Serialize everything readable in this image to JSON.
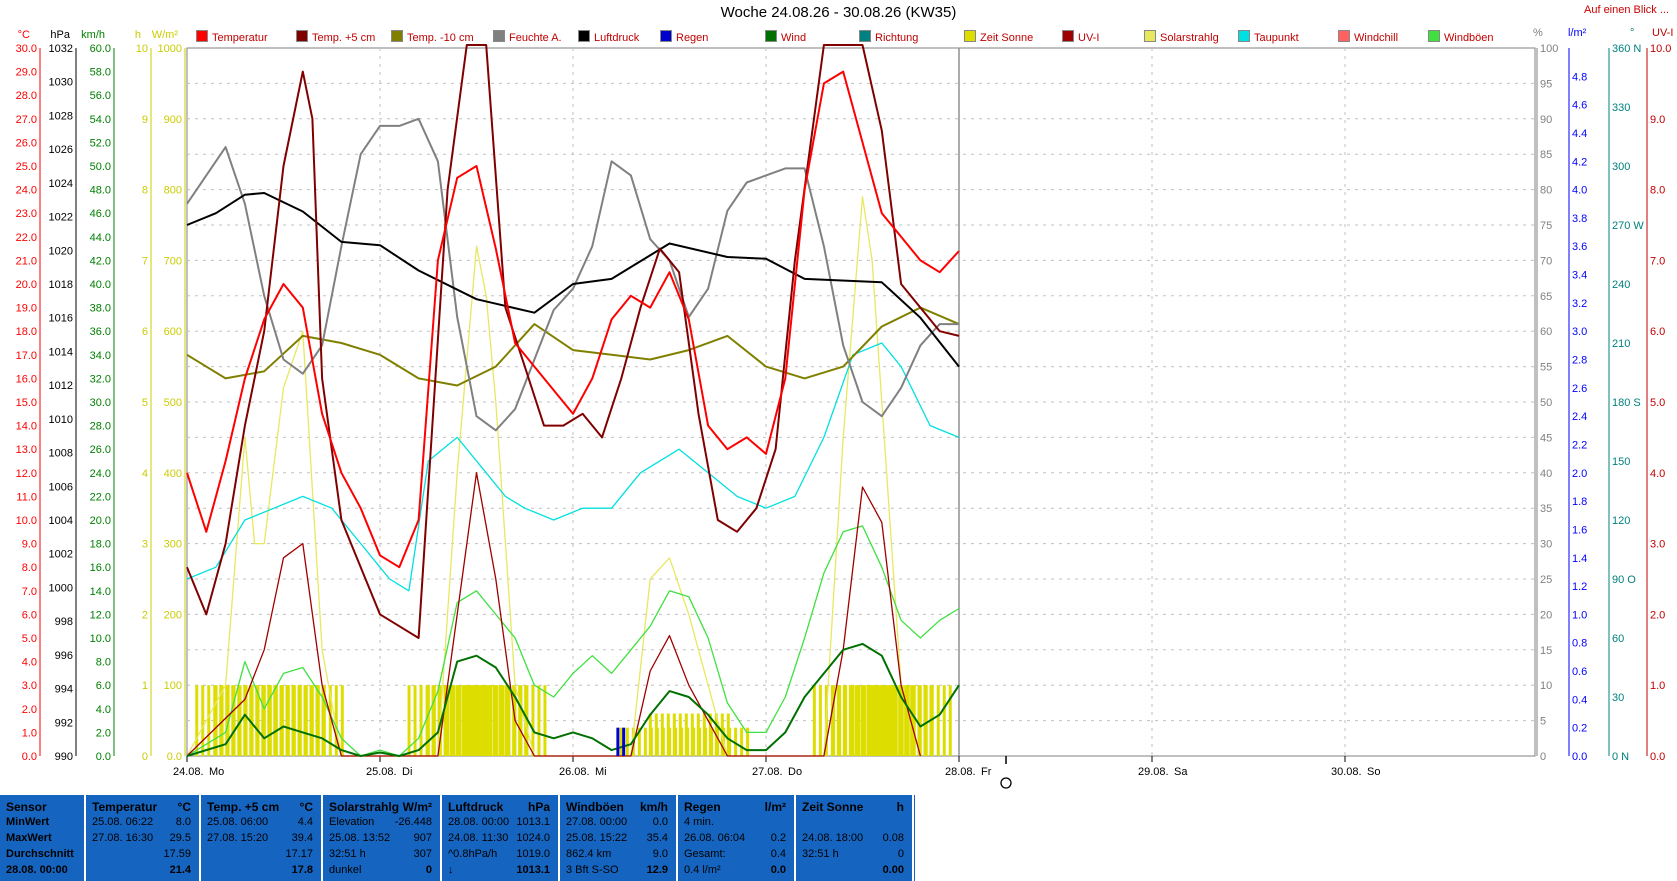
{
  "title": "Woche 24.08.26 - 30.08.26 (KW35)",
  "top_link": "Auf einen Blick ...",
  "colors": {
    "temperatur": "#ff0000",
    "temp5": "#800000",
    "temp10": "#808000",
    "feuchte": "#808080",
    "luftdruck": "#000000",
    "regen": "#0000cc",
    "wind": "#007000",
    "richtung": "#008080",
    "zeit_sonne": "#dddd00",
    "uvi": "#a00000",
    "solar": "#e8e860",
    "taupunkt": "#00e0e0",
    "windchill": "#ff6060",
    "windboeen": "#40e040",
    "footer_bg": "#1565c0"
  },
  "legend": [
    {
      "label": "Temperatur",
      "key": "temperatur"
    },
    {
      "label": "Temp. +5 cm",
      "key": "temp5"
    },
    {
      "label": "Temp. -10 cm",
      "key": "temp10"
    },
    {
      "label": "Feuchte A.",
      "key": "feuchte"
    },
    {
      "label": "Luftdruck",
      "key": "luftdruck"
    },
    {
      "label": "Regen",
      "key": "regen"
    },
    {
      "label": "Wind",
      "key": "wind"
    },
    {
      "label": "Richtung",
      "key": "richtung"
    },
    {
      "label": "Zeit Sonne",
      "key": "zeit_sonne"
    },
    {
      "label": "UV-I",
      "key": "uvi"
    },
    {
      "label": "Solarstrahlg",
      "key": "solar"
    },
    {
      "label": "Taupunkt",
      "key": "taupunkt"
    },
    {
      "label": "Windchill",
      "key": "windchill"
    },
    {
      "label": "Windböen",
      "key": "windboeen"
    }
  ],
  "axis_units": {
    "temp": "°C",
    "hpa": "hPa",
    "kmh": "km/h",
    "h": "h",
    "wm2": "W/m²",
    "pct": "%",
    "lm2": "l/m²",
    "deg": "°",
    "uvi": "UV-I"
  },
  "axes": {
    "temp": [
      "0.0",
      "1.0",
      "2.0",
      "3.0",
      "4.0",
      "5.0",
      "6.0",
      "7.0",
      "8.0",
      "9.0",
      "10.0",
      "11.0",
      "12.0",
      "13.0",
      "14.0",
      "15.0",
      "16.0",
      "17.0",
      "18.0",
      "19.0",
      "20.0",
      "21.0",
      "22.0",
      "23.0",
      "24.0",
      "25.0",
      "26.0",
      "27.0",
      "28.0",
      "29.0",
      "30.0"
    ],
    "hpa": [
      "990",
      "992",
      "994",
      "996",
      "998",
      "1000",
      "1002",
      "1004",
      "1006",
      "1008",
      "1010",
      "1012",
      "1014",
      "1016",
      "1018",
      "1020",
      "1022",
      "1024",
      "1026",
      "1028",
      "1030",
      "1032"
    ],
    "kmh": [
      "0.0",
      "2.0",
      "4.0",
      "6.0",
      "8.0",
      "10.0",
      "12.0",
      "14.0",
      "16.0",
      "18.0",
      "20.0",
      "22.0",
      "24.0",
      "26.0",
      "28.0",
      "30.0",
      "32.0",
      "34.0",
      "36.0",
      "38.0",
      "40.0",
      "42.0",
      "44.0",
      "46.0",
      "48.0",
      "50.0",
      "52.0",
      "54.0",
      "56.0",
      "58.0",
      "60.0"
    ],
    "h": [
      "0",
      "1",
      "2",
      "3",
      "4",
      "5",
      "6",
      "7",
      "8",
      "9",
      "10"
    ],
    "wm2": [
      "0.0",
      "100",
      "200",
      "300",
      "400",
      "500",
      "600",
      "700",
      "800",
      "900",
      "1000"
    ],
    "pct": [
      "0",
      "5",
      "10",
      "15",
      "20",
      "25",
      "30",
      "35",
      "40",
      "45",
      "50",
      "55",
      "60",
      "65",
      "70",
      "75",
      "80",
      "85",
      "90",
      "95",
      "100"
    ],
    "lm2": [
      "0.0",
      "0.2",
      "0.4",
      "0.6",
      "0.8",
      "1.0",
      "1.2",
      "1.4",
      "1.6",
      "1.8",
      "2.0",
      "2.2",
      "2.4",
      "2.6",
      "2.8",
      "3.0",
      "3.2",
      "3.4",
      "3.6",
      "3.8",
      "4.0",
      "4.2",
      "4.4",
      "4.6",
      "4.8"
    ],
    "deg": [
      "0 N",
      "30",
      "60",
      "90 O",
      "120",
      "150",
      "180 S",
      "210",
      "240",
      "270 W",
      "300",
      "330",
      "360 N"
    ],
    "uvi": [
      "0.0",
      "1.0",
      "2.0",
      "3.0",
      "4.0",
      "5.0",
      "6.0",
      "7.0",
      "8.0",
      "9.0",
      "10.0"
    ]
  },
  "days": [
    {
      "date": "24.08.",
      "name": "Mo"
    },
    {
      "date": "25.08.",
      "name": "Di"
    },
    {
      "date": "26.08.",
      "name": "Mi"
    },
    {
      "date": "27.08.",
      "name": "Do"
    },
    {
      "date": "28.08.",
      "name": "Fr"
    },
    {
      "date": "29.08.",
      "name": "Sa"
    },
    {
      "date": "30.08.",
      "name": "So"
    }
  ],
  "chart_data": {
    "type": "line",
    "title": "Woche 24.08.26 - 30.08.26 (KW35)",
    "x_unit": "days from 24.08. 00:00",
    "xlim": [
      0,
      7
    ],
    "series": [
      {
        "name": "Luftdruck",
        "key": "luftdruck",
        "axis": "hpa",
        "ylim": [
          990,
          1032
        ],
        "x": [
          0,
          0.15,
          0.3,
          0.4,
          0.6,
          0.8,
          1.0,
          1.2,
          1.5,
          1.8,
          2.0,
          2.2,
          2.5,
          2.8,
          3.0,
          3.2,
          3.6,
          3.8,
          4.0
        ],
        "y": [
          1021.5,
          1022.2,
          1023.3,
          1023.4,
          1022.3,
          1020.5,
          1020.3,
          1018.8,
          1017.1,
          1016.3,
          1018.0,
          1018.3,
          1020.4,
          1019.6,
          1019.5,
          1018.3,
          1018.1,
          1016.0,
          1013.1
        ]
      },
      {
        "name": "Temperatur",
        "key": "temperatur",
        "axis": "temp",
        "ylim": [
          0,
          30
        ],
        "x": [
          0,
          0.1,
          0.2,
          0.3,
          0.4,
          0.5,
          0.6,
          0.7,
          0.8,
          0.9,
          1.0,
          1.1,
          1.2,
          1.3,
          1.4,
          1.5,
          1.6,
          1.7,
          1.8,
          1.9,
          2.0,
          2.1,
          2.2,
          2.3,
          2.4,
          2.5,
          2.6,
          2.7,
          2.8,
          2.9,
          3.0,
          3.1,
          3.2,
          3.3,
          3.4,
          3.5,
          3.6,
          3.7,
          3.8,
          3.9,
          4.0
        ],
        "y": [
          12.0,
          9.5,
          12.5,
          16.0,
          18.5,
          20.0,
          19.0,
          14.5,
          12.0,
          10.5,
          8.5,
          8.0,
          10.0,
          21.0,
          24.5,
          25.0,
          21.5,
          17.5,
          16.5,
          15.5,
          14.5,
          16.0,
          18.5,
          19.5,
          19.0,
          20.5,
          18.5,
          14.0,
          13.0,
          13.5,
          12.8,
          16.0,
          24.0,
          28.5,
          29.0,
          26.0,
          23.0,
          22.0,
          21.0,
          20.5,
          21.4
        ]
      },
      {
        "name": "Temp. +5 cm",
        "key": "temp5",
        "axis": "temp",
        "ylim": [
          0,
          30
        ],
        "x": [
          0,
          0.1,
          0.2,
          0.3,
          0.4,
          0.5,
          0.6,
          0.65,
          0.7,
          0.8,
          0.9,
          1.0,
          1.1,
          1.2,
          1.35,
          1.45,
          1.55,
          1.65,
          1.75,
          1.85,
          1.95,
          2.05,
          2.15,
          2.25,
          2.35,
          2.45,
          2.55,
          2.65,
          2.75,
          2.85,
          2.95,
          3.05,
          3.15,
          3.3,
          3.4,
          3.5,
          3.6,
          3.7,
          3.8,
          3.9,
          4.0
        ],
        "y": [
          8.0,
          6.0,
          9.0,
          14.0,
          18.0,
          25.0,
          29.0,
          27.0,
          16.0,
          10.0,
          8.0,
          6.0,
          5.5,
          5.0,
          24.0,
          32.0,
          32.0,
          19.0,
          16.5,
          14.0,
          14.0,
          14.5,
          13.5,
          16.0,
          19.0,
          21.5,
          20.5,
          14.5,
          10.0,
          9.5,
          10.5,
          13.0,
          21.0,
          35.0,
          39.4,
          33.0,
          26.5,
          20.0,
          19.0,
          18.0,
          17.8
        ]
      },
      {
        "name": "Temp. -10 cm",
        "key": "temp10",
        "axis": "temp",
        "ylim": [
          0,
          30
        ],
        "x": [
          0,
          0.2,
          0.4,
          0.6,
          0.8,
          1.0,
          1.2,
          1.4,
          1.6,
          1.8,
          2.0,
          2.2,
          2.4,
          2.6,
          2.8,
          3.0,
          3.2,
          3.4,
          3.6,
          3.8,
          4.0
        ],
        "y": [
          17.0,
          16.0,
          16.3,
          17.8,
          17.5,
          17.0,
          16.0,
          15.7,
          16.5,
          18.3,
          17.2,
          17.0,
          16.8,
          17.2,
          17.8,
          16.5,
          16.0,
          16.5,
          18.2,
          19.0,
          18.3
        ]
      },
      {
        "name": "Feuchte A.",
        "key": "feuchte",
        "axis": "pct",
        "ylim": [
          0,
          100
        ],
        "x": [
          0,
          0.1,
          0.2,
          0.3,
          0.4,
          0.5,
          0.6,
          0.7,
          0.8,
          0.9,
          1.0,
          1.1,
          1.2,
          1.3,
          1.4,
          1.5,
          1.6,
          1.7,
          1.8,
          1.9,
          2.0,
          2.1,
          2.2,
          2.3,
          2.4,
          2.5,
          2.6,
          2.7,
          2.8,
          2.9,
          3.0,
          3.1,
          3.2,
          3.3,
          3.4,
          3.5,
          3.6,
          3.7,
          3.8,
          3.9,
          4.0
        ],
        "y": [
          78,
          82,
          86,
          78,
          65,
          56,
          54,
          58,
          72,
          85,
          89,
          89,
          90,
          84,
          62,
          48,
          46,
          49,
          56,
          63,
          66,
          72,
          84,
          82,
          73,
          70,
          62,
          66,
          77,
          81,
          82,
          83,
          83,
          72,
          58,
          50,
          48,
          52,
          58,
          61,
          61
        ]
      },
      {
        "name": "Taupunkt",
        "key": "taupunkt",
        "axis": "temp",
        "ylim": [
          0,
          30
        ],
        "x": [
          0,
          0.15,
          0.3,
          0.45,
          0.6,
          0.75,
          0.9,
          1.05,
          1.15,
          1.25,
          1.4,
          1.55,
          1.65,
          1.75,
          1.9,
          2.05,
          2.2,
          2.35,
          2.55,
          2.7,
          2.85,
          3.0,
          3.15,
          3.3,
          3.45,
          3.6,
          3.7,
          3.85,
          4.0
        ],
        "y": [
          7.5,
          8.0,
          10.0,
          10.5,
          11.0,
          10.5,
          9.0,
          7.5,
          7.0,
          12.5,
          13.5,
          12.0,
          11.0,
          10.5,
          10.0,
          10.5,
          10.5,
          12.0,
          13.0,
          12.0,
          11.0,
          10.5,
          11.0,
          13.5,
          17.0,
          17.5,
          16.5,
          14.0,
          13.5
        ]
      },
      {
        "name": "Wind",
        "key": "wind",
        "axis": "kmh",
        "ylim": [
          0,
          60
        ],
        "x": [
          0,
          0.2,
          0.3,
          0.4,
          0.5,
          0.6,
          0.7,
          0.8,
          0.9,
          1.0,
          1.1,
          1.2,
          1.3,
          1.4,
          1.5,
          1.6,
          1.7,
          1.8,
          1.9,
          2.0,
          2.1,
          2.2,
          2.3,
          2.4,
          2.5,
          2.6,
          2.7,
          2.8,
          2.9,
          3.0,
          3.1,
          3.2,
          3.3,
          3.4,
          3.5,
          3.6,
          3.7,
          3.8,
          3.9,
          4.0
        ],
        "y": [
          0,
          1.0,
          3.5,
          1.5,
          2.5,
          2.0,
          1.5,
          0.5,
          0,
          0.3,
          0,
          0.5,
          2.0,
          8.0,
          8.5,
          7.5,
          5.0,
          2.0,
          1.5,
          2.0,
          1.5,
          0.5,
          1.0,
          3.5,
          5.5,
          5.0,
          3.5,
          1.5,
          0.5,
          0.5,
          2.0,
          5.0,
          7.0,
          9.0,
          9.5,
          8.5,
          5.0,
          2.5,
          3.5,
          6.0
        ]
      },
      {
        "name": "Windböen",
        "key": "windboeen",
        "axis": "kmh",
        "ylim": [
          0,
          60
        ],
        "x": [
          0,
          0.2,
          0.3,
          0.4,
          0.5,
          0.6,
          0.7,
          0.8,
          0.9,
          1.0,
          1.1,
          1.2,
          1.3,
          1.4,
          1.5,
          1.6,
          1.7,
          1.8,
          1.9,
          2.0,
          2.1,
          2.2,
          2.3,
          2.4,
          2.5,
          2.6,
          2.7,
          2.8,
          2.9,
          3.0,
          3.1,
          3.2,
          3.3,
          3.4,
          3.5,
          3.6,
          3.7,
          3.8,
          3.9,
          4.0
        ],
        "y": [
          0,
          2.0,
          8.0,
          4.0,
          7.0,
          7.5,
          5.0,
          1.5,
          0,
          0.5,
          0,
          1.5,
          5.5,
          13.0,
          14.0,
          12.0,
          10.0,
          6.0,
          5.0,
          7.0,
          8.5,
          7.0,
          9.0,
          11.0,
          14.0,
          13.5,
          10.0,
          4.5,
          2.0,
          2.0,
          5.0,
          10.0,
          15.5,
          19.0,
          19.5,
          16.0,
          11.5,
          10.0,
          11.5,
          12.5
        ]
      },
      {
        "name": "UV-I",
        "key": "uvi",
        "axis": "uvi",
        "ylim": [
          0,
          10
        ],
        "x": [
          0,
          0.3,
          0.4,
          0.5,
          0.6,
          0.7,
          0.8,
          1.3,
          1.4,
          1.5,
          1.6,
          1.7,
          1.8,
          2.3,
          2.4,
          2.5,
          2.6,
          2.7,
          2.8,
          3.3,
          3.4,
          3.5,
          3.6,
          3.7,
          3.8
        ],
        "y": [
          0,
          0.8,
          1.5,
          2.8,
          3.0,
          1.0,
          0,
          0,
          2.0,
          4.0,
          2.5,
          0.5,
          0,
          0,
          1.2,
          1.7,
          1.0,
          0.5,
          0,
          0,
          1.5,
          3.8,
          3.3,
          1.0,
          0
        ]
      },
      {
        "name": "Solarstrahlg",
        "key": "solar",
        "axis": "wm2",
        "ylim": [
          0,
          1000
        ],
        "x": [
          0,
          0.2,
          0.3,
          0.35,
          0.4,
          0.5,
          0.6,
          0.7,
          0.8,
          1.3,
          1.4,
          1.5,
          1.55,
          1.6,
          1.7,
          1.8,
          2.3,
          2.4,
          2.5,
          2.6,
          2.7,
          2.8,
          3.3,
          3.4,
          3.5,
          3.55,
          3.6,
          3.7,
          3.8
        ],
        "y": [
          0,
          100,
          450,
          300,
          300,
          520,
          600,
          150,
          0,
          0,
          400,
          720,
          650,
          500,
          100,
          0,
          0,
          250,
          280,
          200,
          100,
          0,
          0,
          450,
          790,
          700,
          500,
          100,
          0
        ]
      },
      {
        "name": "Zeit Sonne",
        "key": "zeit_sonne",
        "axis": "h",
        "ylim": [
          0,
          10
        ],
        "x": [
          0.25,
          0.35,
          0.5,
          0.6,
          1.35,
          1.45,
          1.55,
          1.65,
          2.45,
          2.6,
          2.7,
          3.45,
          3.55,
          3.65,
          3.75
        ],
        "y": [
          1,
          1,
          1,
          1,
          1,
          1,
          1,
          1,
          0.4,
          0.6,
          0.4,
          1,
          1,
          1,
          1
        ]
      },
      {
        "name": "Regen",
        "key": "regen",
        "axis": "lm2",
        "ylim": [
          0,
          5
        ],
        "x": [
          2.23,
          2.26
        ],
        "y": [
          0.2,
          0.2
        ]
      }
    ]
  },
  "footer": {
    "sensor": {
      "head": "Sensor",
      "rows": [
        "MinWert",
        "MaxWert",
        "Durchschnitt",
        "28.08. 00:00"
      ]
    },
    "temperatur": {
      "head": "Temperatur",
      "unit": "°C",
      "rows": [
        [
          "25.08.  06:22",
          "8.0"
        ],
        [
          "27.08.  16:30",
          "29.5"
        ],
        [
          "",
          "17.59"
        ],
        [
          "",
          "21.4"
        ]
      ]
    },
    "temp5": {
      "head": "Temp. +5 cm",
      "unit": "°C",
      "rows": [
        [
          "25.08.  06:00",
          "4.4"
        ],
        [
          "27.08.  15:20",
          "39.4"
        ],
        [
          "",
          "17.17"
        ],
        [
          "",
          "17.8"
        ]
      ]
    },
    "solar": {
      "head": "Solarstrahlg",
      "unit": "W/m²",
      "rows": [
        [
          "Elevation",
          "-26.448"
        ],
        [
          "25.08.  13:52",
          "907"
        ],
        [
          "32:51 h",
          "307"
        ],
        [
          "dunkel",
          "0"
        ]
      ]
    },
    "luftdruck": {
      "head": "Luftdruck",
      "unit": "hPa",
      "rows": [
        [
          "28.08.  00:00",
          "1013.1"
        ],
        [
          "24.08.  11:30",
          "1024.0"
        ],
        [
          "^0.8hPa/h",
          "1019.0"
        ],
        [
          "↓",
          "1013.1"
        ]
      ]
    },
    "windboeen": {
      "head": "Windböen",
      "unit": "km/h",
      "rows": [
        [
          "27.08.  00:00",
          "0.0"
        ],
        [
          "25.08.  15:22",
          "35.4"
        ],
        [
          "862.4 km",
          "9.0"
        ],
        [
          "3 Bft S-SO",
          "12.9"
        ]
      ]
    },
    "regen": {
      "head": "Regen",
      "unit": "l/m²",
      "rows": [
        [
          "4 min.",
          ""
        ],
        [
          "26.08.  06:04",
          "0.2"
        ],
        [
          "Gesamt:",
          "0.4"
        ],
        [
          "0.4 l/m²",
          "0.0"
        ]
      ]
    },
    "sonne": {
      "head": "Zeit Sonne",
      "unit": "h",
      "rows": [
        [
          "",
          ""
        ],
        [
          "24.08.  18:00",
          "0.08"
        ],
        [
          "32:51 h",
          "0"
        ],
        [
          "",
          "0.00"
        ]
      ]
    }
  }
}
